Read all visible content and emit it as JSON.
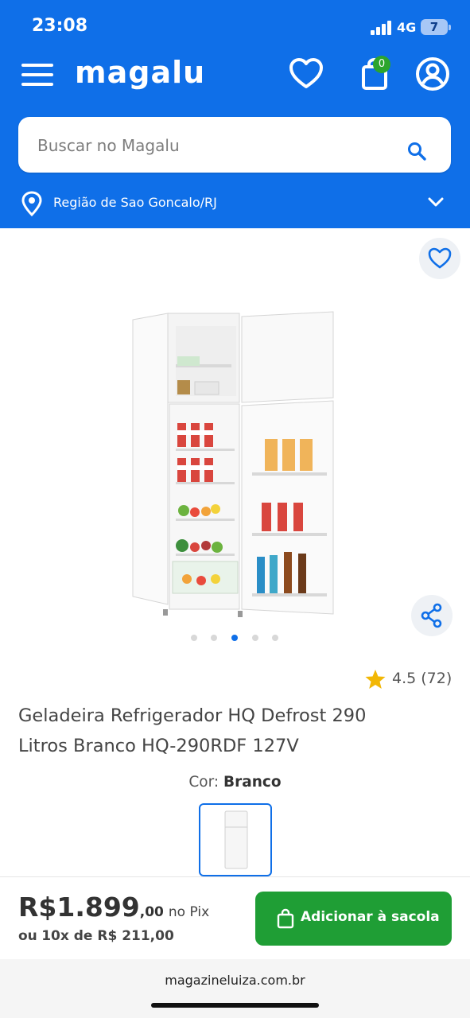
{
  "status_bar": {
    "time": "23:08",
    "network": "4G",
    "battery": "7"
  },
  "header": {
    "logo": "magalu",
    "cart_count": "0"
  },
  "search": {
    "placeholder": "Buscar no Magalu"
  },
  "region": {
    "label": "Região de Sao Goncalo/RJ"
  },
  "gallery": {
    "dots": 5,
    "active_dot": 3
  },
  "rating": {
    "value": "4.5",
    "count": "(72)"
  },
  "product": {
    "title_line1": "Geladeira Refrigerador HQ Defrost 290",
    "title_line2": "Litros Branco HQ-290RDF 127V",
    "color_label": "Cor:",
    "color_value": "Branco"
  },
  "purchase": {
    "price_main": "R$1.899",
    "price_cents": ",00",
    "price_method": "no Pix",
    "installments_prefix": "ou",
    "installments": "10x de R$ 211,00",
    "add_button": "Adicionar à sacola"
  },
  "browser": {
    "url": "magazineluiza.com.br"
  },
  "colors": {
    "brand_blue": "#0f6fe8",
    "button_green": "#1f9e35",
    "badge_green": "#2ca52c",
    "star": "#f2b705"
  }
}
